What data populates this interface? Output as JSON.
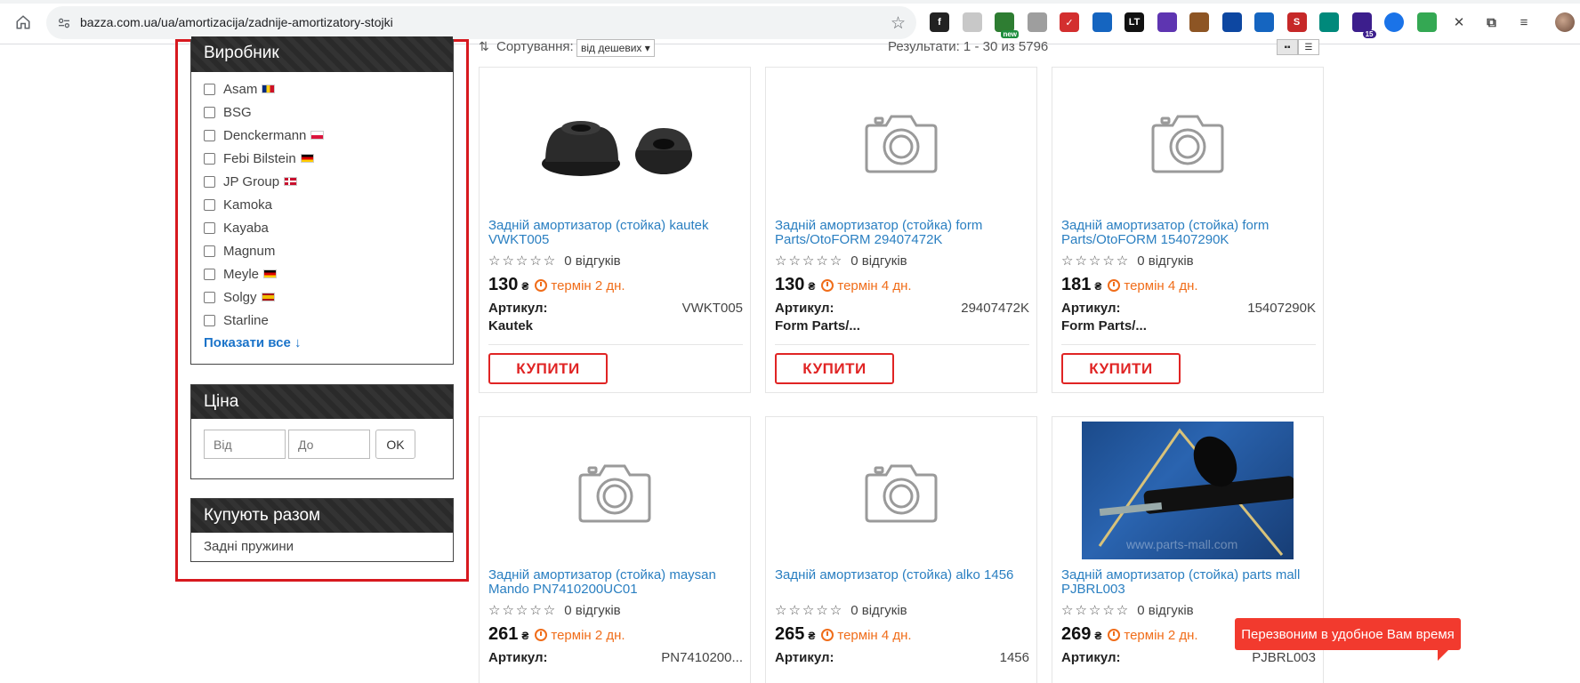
{
  "browser": {
    "url": "bazza.com.ua/ua/amortizacija/zadnije-amortizatory-stojki",
    "extensions": [
      {
        "icon": "font-icon",
        "label": "f",
        "color": "#222222"
      },
      {
        "icon": "leaf-icon",
        "label": "",
        "color": "#c8c8c8"
      },
      {
        "icon": "android-new-icon",
        "label": "",
        "color": "#2e7d32",
        "badge": "new"
      },
      {
        "icon": "camera-icon",
        "label": "",
        "color": "#9e9e9e"
      },
      {
        "icon": "check-icon",
        "label": "✓",
        "color": "#d32f2f"
      },
      {
        "icon": "scissors-icon",
        "label": "",
        "color": "#1565c0"
      },
      {
        "icon": "lt-icon",
        "label": "LT",
        "color": "#111111"
      },
      {
        "icon": "gear-circle-icon",
        "label": "",
        "color": "#5e35b1"
      },
      {
        "icon": "cookie-icon",
        "label": "",
        "color": "#8d5524"
      },
      {
        "icon": "hexagon-icon",
        "label": "",
        "color": "#0d47a1"
      },
      {
        "icon": "at-icon",
        "label": "",
        "color": "#1565c0"
      },
      {
        "icon": "s-icon",
        "label": "S",
        "color": "#c62828"
      },
      {
        "icon": "frame-icon",
        "label": "",
        "color": "#00897b"
      },
      {
        "icon": "home-badge-icon",
        "label": "",
        "color": "#3c1e8c",
        "badge": "15"
      },
      {
        "icon": "blue-dot-icon",
        "label": "",
        "color": "#1a73e8"
      },
      {
        "icon": "google-icon",
        "label": "",
        "color": "#34a853"
      },
      {
        "icon": "x-icon",
        "label": "✕",
        "color": "#444444"
      },
      {
        "icon": "puzzle-icon",
        "label": "",
        "color": "#444444"
      },
      {
        "icon": "playlist-icon",
        "label": "",
        "color": "#444444"
      }
    ]
  },
  "sidebar": {
    "brands_title": "Виробник",
    "brands": [
      {
        "name": "Asam",
        "flag": "ro"
      },
      {
        "name": "BSG",
        "flag": ""
      },
      {
        "name": "Denckermann",
        "flag": "pl"
      },
      {
        "name": "Febi Bilstein",
        "flag": "de"
      },
      {
        "name": "JP Group",
        "flag": "dk"
      },
      {
        "name": "Kamoka",
        "flag": ""
      },
      {
        "name": "Kayaba",
        "flag": ""
      },
      {
        "name": "Magnum",
        "flag": ""
      },
      {
        "name": "Meyle",
        "flag": "de"
      },
      {
        "name": "Solgy",
        "flag": "es"
      },
      {
        "name": "Starline",
        "flag": ""
      }
    ],
    "show_all": "Показати все ↓",
    "price_title": "Ціна",
    "price_from_placeholder": "Від",
    "price_to_placeholder": "До",
    "price_ok": "OK",
    "together_title": "Купують разом",
    "together_items": [
      "Задні пружини"
    ]
  },
  "sort": {
    "label": "Сортування:",
    "selected": "від дешевих ▾",
    "results": "Результати: 1 - 30 из 5796"
  },
  "products": [
    {
      "title": "Задній амортизатор (стойка) kautek VWKT005",
      "reviews": "0 відгуків",
      "price": "130",
      "currency": "₴",
      "term": "термін 2 дн.",
      "art_label": "Артикул:",
      "art": "VWKT005",
      "brand": "Kautek",
      "buy": "КУПИТИ",
      "image": "rubber-mount"
    },
    {
      "title": "Задній амортизатор (стойка) form Parts/OtoFORM 29407472K",
      "reviews": "0 відгуків",
      "price": "130",
      "currency": "₴",
      "term": "термін 4 дн.",
      "art_label": "Артикул:",
      "art": "29407472K",
      "brand": "Form Parts/...",
      "buy": "КУПИТИ",
      "image": "camera"
    },
    {
      "title": "Задній амортизатор (стойка) form Parts/OtoFORM 15407290K",
      "reviews": "0 відгуків",
      "price": "181",
      "currency": "₴",
      "term": "термін 4 дн.",
      "art_label": "Артикул:",
      "art": "15407290K",
      "brand": "Form Parts/...",
      "buy": "КУПИТИ",
      "image": "camera"
    },
    {
      "title": "Задній амортизатор (стойка) maysan Mando PN7410200UC01",
      "reviews": "0 відгуків",
      "price": "261",
      "currency": "₴",
      "term": "термін 2 дн.",
      "art_label": "Артикул:",
      "art": "PN7410200...",
      "brand": "",
      "buy": "КУПИТИ",
      "image": "camera"
    },
    {
      "title": "Задній амортизатор (стойка) alko 1456",
      "reviews": "0 відгуків",
      "price": "265",
      "currency": "₴",
      "term": "термін 4 дн.",
      "art_label": "Артикул:",
      "art": "1456",
      "brand": "",
      "buy": "КУПИТИ",
      "image": "camera"
    },
    {
      "title": "Задній амортизатор (стойка) parts mall PJBRL003",
      "reviews": "0 відгуків",
      "price": "269",
      "currency": "₴",
      "term": "термін 2 дн.",
      "art_label": "Артикул:",
      "art": "PJBRL003",
      "brand": "",
      "buy": "КУПИТИ",
      "image": "shock-photo",
      "watermark": "www.parts-mall.com"
    }
  ],
  "stars": "☆☆☆☆☆",
  "callback": "Перезвоним в удобное Вам время",
  "colors": {
    "accent_red": "#e02424",
    "link_blue": "#2a7fc1",
    "term_orange": "#f06d1a",
    "panel_header": "#2d2d2d",
    "highlight_frame": "#d7191f"
  }
}
